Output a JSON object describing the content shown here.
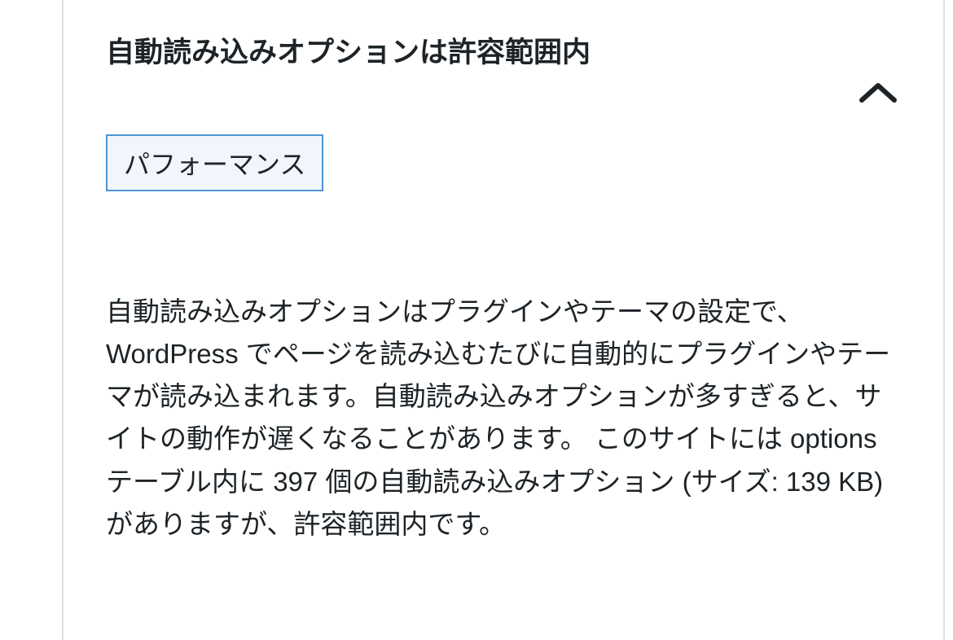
{
  "health_check": {
    "title": "自動読み込みオプションは許容範囲内",
    "badge_label": "パフォーマンス",
    "description": "自動読み込みオプションはプラグインやテーマの設定で、WordPress でページを読み込むたびに自動的にプラグインやテーマが読み込まれます。自動読み込みオプションが多すぎると、サイトの動作が遅くなることがあります。 このサイトには options テーブル内に 397 個の自動読み込みオプション (サイズ: 139 KB) がありますが、許容範囲内です。"
  }
}
